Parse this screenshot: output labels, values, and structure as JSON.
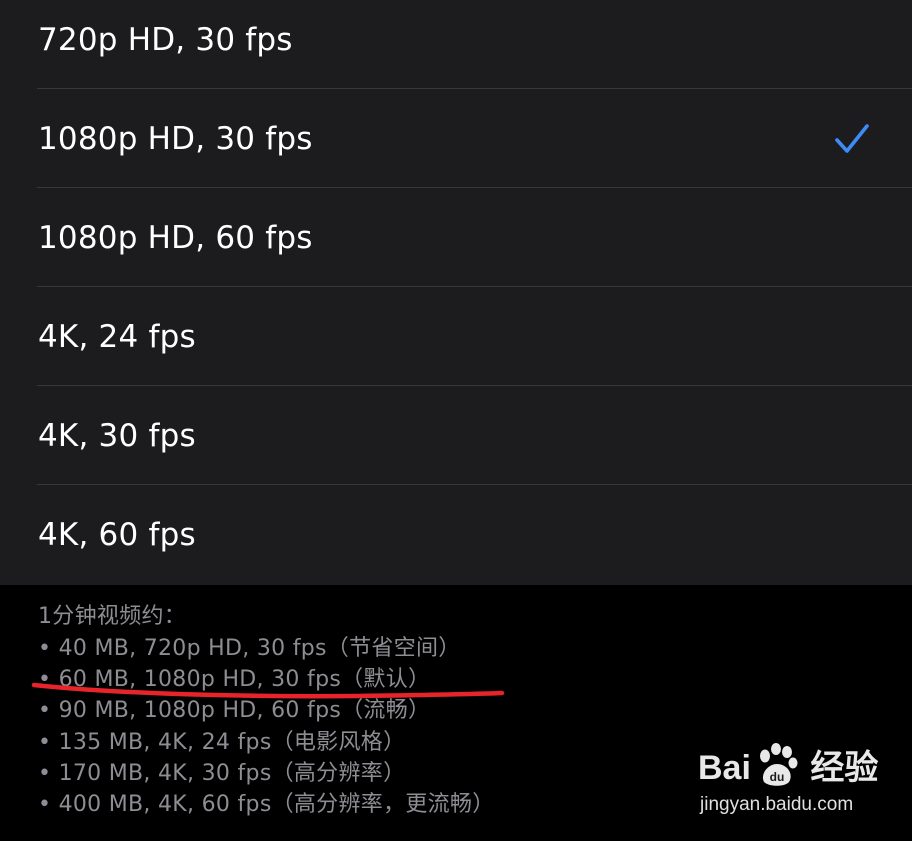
{
  "options": [
    {
      "label": "720p HD, 30 fps",
      "selected": false
    },
    {
      "label": "1080p HD, 30 fps",
      "selected": true
    },
    {
      "label": "1080p HD, 60 fps",
      "selected": false
    },
    {
      "label": "4K, 24 fps",
      "selected": false
    },
    {
      "label": "4K, 30 fps",
      "selected": false
    },
    {
      "label": "4K, 60 fps",
      "selected": false
    }
  ],
  "check_icon": "checkmark-icon",
  "accent_color": "#3e8bf7",
  "annotation_color": "#e8242b",
  "footer": {
    "heading": "1分钟视频约：",
    "lines": [
      "• 40 MB, 720p HD, 30 fps（节省空间）",
      "• 60 MB, 1080p HD, 30 fps（默认）",
      "• 90 MB, 1080p HD, 60 fps（流畅）",
      "• 135 MB, 4K, 24 fps（电影风格）",
      "• 170 MB, 4K, 30 fps（高分辨率）",
      "• 400 MB, 4K, 60 fps（高分辨率，更流畅）"
    ]
  },
  "watermark": {
    "brand": "Bai 经验",
    "url": "jingyan.baidu.com"
  }
}
